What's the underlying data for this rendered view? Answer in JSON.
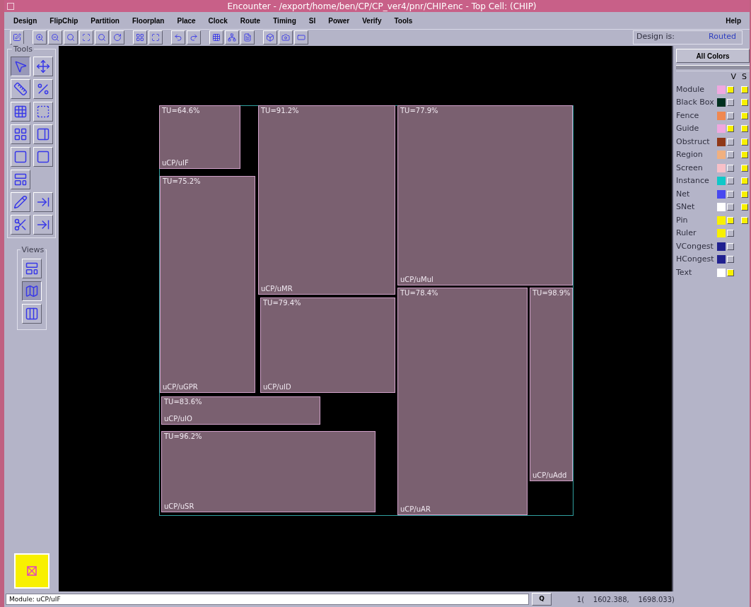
{
  "window": {
    "title": "Encounter - /export/home/ben/CP/CP_ver4/pnr/CHIP.enc - Top Cell: (CHIP)"
  },
  "menu": [
    "Design",
    "FlipChip",
    "Partition",
    "Floorplan",
    "Place",
    "Clock",
    "Route",
    "Timing",
    "SI",
    "Power",
    "Verify",
    "Tools"
  ],
  "help_menu": "Help",
  "design_status": {
    "label": "Design is:",
    "value": "Routed"
  },
  "tools_panel": {
    "title": "Tools",
    "views_title": "Views",
    "tools": [
      {
        "selected": true
      },
      {
        "selected": false
      },
      {
        "selected": false
      },
      {
        "selected": false
      },
      {
        "selected": false
      },
      {
        "selected": false
      },
      {
        "selected": false
      },
      {
        "selected": false
      },
      {
        "selected": false
      },
      {
        "selected": false
      },
      {
        "selected": false
      },
      {
        "selected": false
      },
      {
        "selected": false
      },
      {
        "selected": false
      },
      {
        "selected": false
      }
    ],
    "views": [
      {
        "selected": false
      },
      {
        "selected": true
      },
      {
        "selected": false
      }
    ]
  },
  "modules": [
    {
      "tu": "TU=64.6%",
      "name": "uCP/uIF"
    },
    {
      "tu": "TU=91.2%",
      "name": "uCP/uMR"
    },
    {
      "tu": "TU=77.9%",
      "name": "uCP/uMul"
    },
    {
      "tu": "TU=75.2%",
      "name": "uCP/uGPR"
    },
    {
      "tu": "TU=79.4%",
      "name": "uCP/uID"
    },
    {
      "tu": "TU=78.4%",
      "name": "uCP/uAR"
    },
    {
      "tu": "TU=98.9%",
      "name": "uCP/uAdd"
    },
    {
      "tu": "TU=83.6%",
      "name": "uCP/uIO"
    },
    {
      "tu": "TU=96.2%",
      "name": "uCP/uSR"
    }
  ],
  "colors_panel": {
    "button": "All Colors",
    "col_v": "V",
    "col_s": "S",
    "items": [
      {
        "label": "Module",
        "color": "#f0a8e0",
        "v": true,
        "s": true
      },
      {
        "label": "Black Box",
        "color": "#003020",
        "v": false,
        "s": true
      },
      {
        "label": "Fence",
        "color": "#f08850",
        "v": false,
        "s": true
      },
      {
        "label": "Guide",
        "color": "#f0a8e0",
        "v": true,
        "s": true
      },
      {
        "label": "Obstruct",
        "color": "#903818",
        "v": false,
        "s": true
      },
      {
        "label": "Region",
        "color": "#f0b080",
        "v": false,
        "s": true
      },
      {
        "label": "Screen",
        "color": "#f8c0c8",
        "v": false,
        "s": true
      },
      {
        "label": "Instance",
        "color": "#10c8c8",
        "v": false,
        "s": true
      },
      {
        "label": "Net",
        "color": "#4848f0",
        "v": false,
        "s": true
      },
      {
        "label": "SNet",
        "color": "#ffffff",
        "v": false,
        "s": true
      },
      {
        "label": "Pin",
        "color": "#f8f000",
        "v": true,
        "s": true
      },
      {
        "label": "Ruler",
        "color": "#f8f000",
        "v": false
      },
      {
        "label": "VCongest",
        "color": "#202090",
        "v": false
      },
      {
        "label": "HCongest",
        "color": "#202090",
        "v": false
      },
      {
        "label": "Text",
        "color": "#ffffff",
        "v": true
      }
    ]
  },
  "status_bar": {
    "message": "Module: uCP/uIF",
    "button": "Q",
    "coords": "1(    1602.388,    1698.033)"
  }
}
